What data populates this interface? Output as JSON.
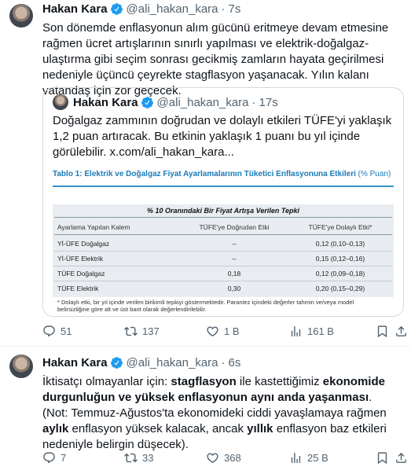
{
  "colors": {
    "verified": "#1d9bf0",
    "text": "#0f1419",
    "secondary": "#536471",
    "border": "#cfd9de",
    "table_accent": "#1b7ab8"
  },
  "tweet1": {
    "name": "Hakan Kara",
    "handle": "@ali_hakan_kara",
    "dot": "·",
    "time": "7s",
    "text": "Son dönemde enflasyonun alım gücünü eritmeye devam etmesine rağmen ücret artışlarının sınırlı yapılması ve elektrik-doğalgaz-ulaştırma gibi seçim sonrası gecikmiş zamların hayata geçirilmesi nedeniyle üçüncü çeyrekte stagflasyon yaşanacak. Yılın kalanı vatandaş için zor geçecek.",
    "quote": {
      "name": "Hakan Kara",
      "handle": "@ali_hakan_kara",
      "dot": "·",
      "time": "17s",
      "text": "Doğalgaz zammının doğrudan ve dolaylı etkileri TÜFE'yi yaklaşık 1,2 puan artıracak. Bu etkinin yaklaşık 1 puanı bu yıl içinde görülebilir. x.com/ali_hakan_kara...",
      "table": {
        "title": "Tablo 1: Elektrik ve Doğalgaz Fiyat Ayarlamalarının Tüketici Enflasyonuna Etkileri",
        "unit": "(% Puan)",
        "subtitle": "% 10 Oranındaki Bir Fiyat Artışa Verilen Tepki",
        "headers": [
          "Ayarlama Yapılan Kalem",
          "TÜFE'ye Doğrudan Etki",
          "TÜFE'ye Dolaylı Etki*"
        ],
        "rows": [
          [
            "Yİ-ÜFE Doğalgaz",
            "--",
            "0,12 (0,10–0,13)"
          ],
          [
            "Yİ-ÜFE Elektrik",
            "--",
            "0,15 (0,12–0,16)"
          ],
          [
            "TÜFE Doğalgaz",
            "0,18",
            "0,12 (0,09–0,18)"
          ],
          [
            "TÜFE Elektrik",
            "0,30",
            "0,20 (0,15–0,29)"
          ]
        ],
        "note": "* Dolaylı etki, bir yıl içinde verilen birikimli tepkiyi göstermektedir. Parantez içindeki değerler tahmin ve/veya model belirsizliğine göre alt ve üst bant olarak değerlendirilebilir."
      }
    },
    "actions": {
      "replies": "51",
      "retweets": "137",
      "likes": "1 B",
      "views": "161 B"
    }
  },
  "tweet2": {
    "name": "Hakan Kara",
    "handle": "@ali_hakan_kara",
    "dot": "·",
    "time": "6s",
    "text_parts": {
      "p1": "İktisatçı olmayanlar için: ",
      "b1": "stagflasyon",
      "p2": " ile kastettiğimiz ",
      "b2": "ekonomide durgunluğun ve yüksek enflasyonun aynı anda yaşanması",
      "p3": ".",
      "p4": "(Not: Temmuz-Ağustos'ta ekonomideki ciddi yavaşlamaya rağmen ",
      "b3": "aylık",
      "p5": " enflasyon yüksek kalacak, ancak ",
      "b4": "yıllık",
      "p6": " enflasyon baz etkileri nedeniyle belirgin düşecek)."
    },
    "actions": {
      "replies": "7",
      "retweets": "33",
      "likes": "368",
      "views": "25 B"
    }
  },
  "icons": [
    "verified-badge-icon",
    "reply-icon",
    "retweet-icon",
    "like-icon",
    "views-icon",
    "bookmark-icon",
    "share-icon"
  ]
}
